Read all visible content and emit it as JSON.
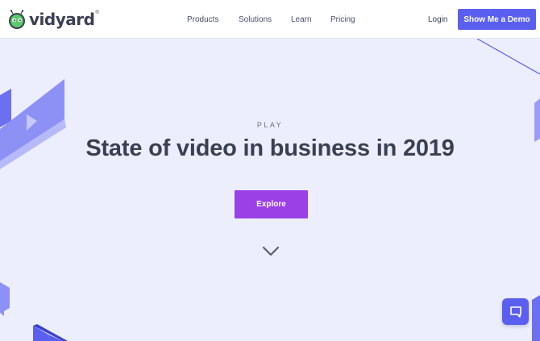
{
  "header": {
    "logo_text": "vidyard",
    "logo_reg": "®",
    "nav": {
      "products": "Products",
      "solutions": "Solutions",
      "learn": "Learn",
      "pricing": "Pricing"
    },
    "login": "Login",
    "demo_button": "Show Me a Demo"
  },
  "hero": {
    "eyebrow": "PLAY",
    "headline": "State of video in business in 2019",
    "explore_button": "Explore"
  },
  "colors": {
    "brand_purple": "#5b5ff0",
    "explore_purple": "#9b3fe7",
    "hero_background": "#eceefd",
    "heading_text": "#3a3f52"
  },
  "icons": {
    "logo": "vidyard-robot-icon",
    "scroll": "chevron-down-icon",
    "chat": "chat-bubble-icon"
  }
}
